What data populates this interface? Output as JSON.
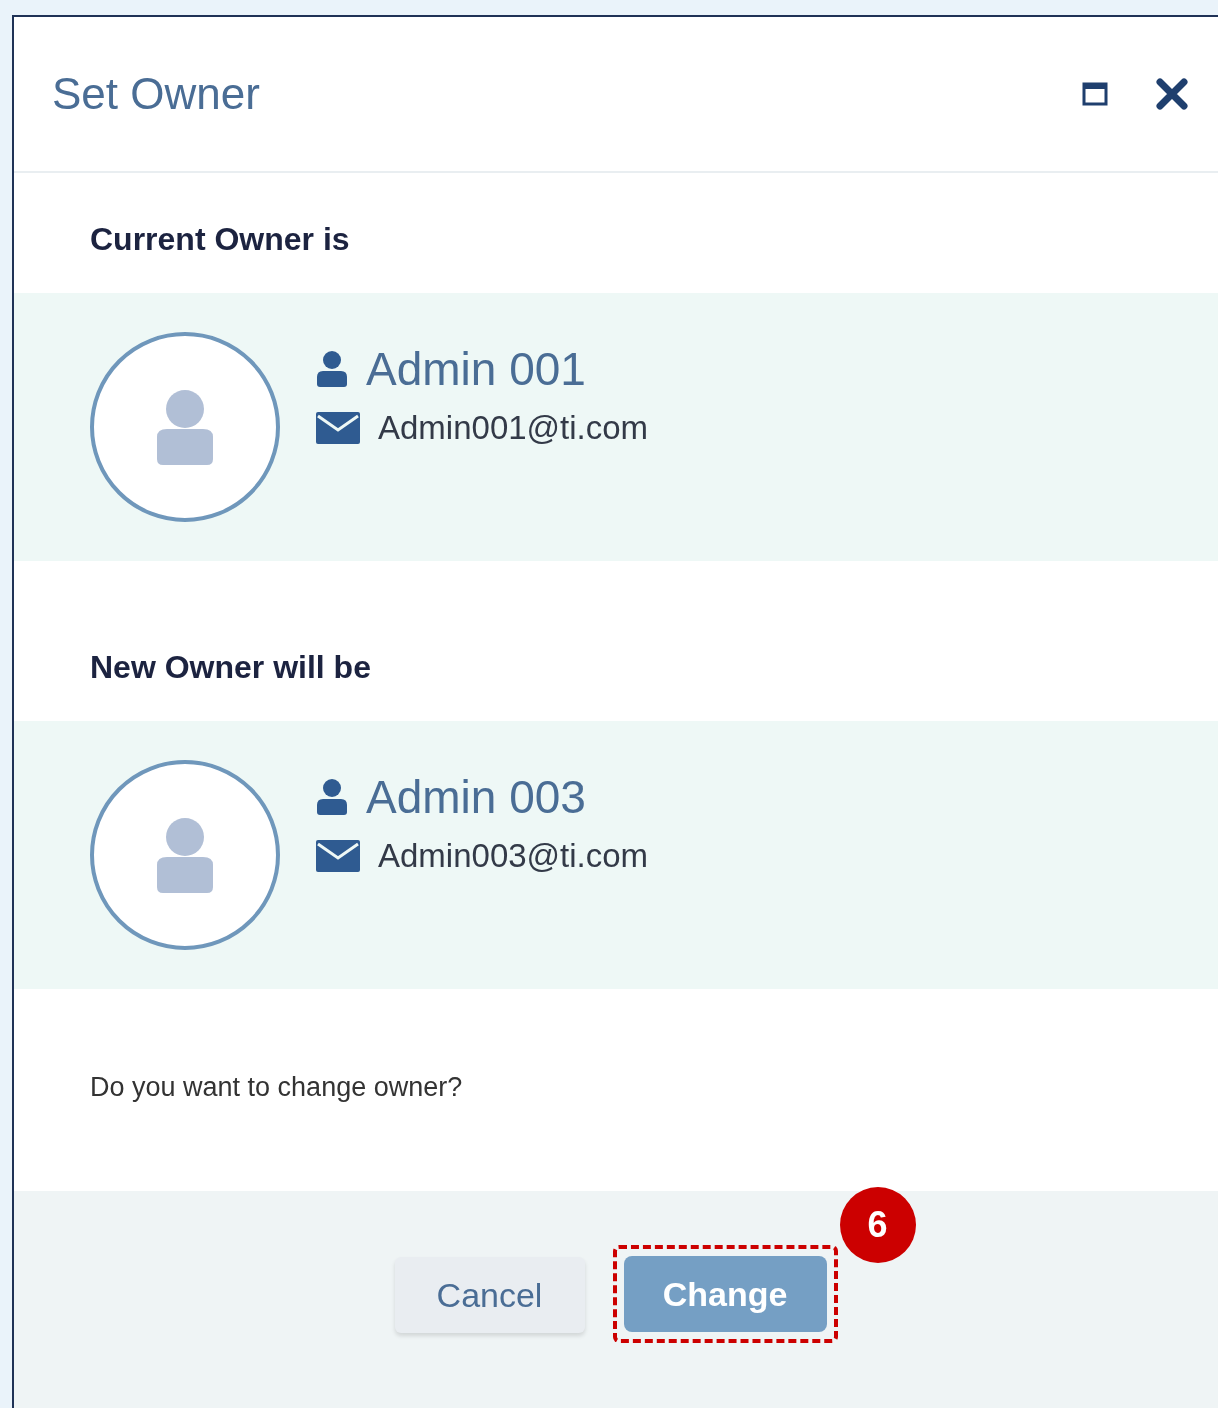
{
  "dialog": {
    "title": "Set Owner"
  },
  "sections": [
    {
      "heading": "Current Owner is",
      "owner": {
        "name": "Admin 001",
        "email": "Admin001@ti.com"
      }
    },
    {
      "heading": "New Owner will be",
      "owner": {
        "name": "Admin 003",
        "email": "Admin003@ti.com"
      }
    }
  ],
  "question": "Do you want to change owner?",
  "buttons": [
    {
      "label": "Cancel",
      "kind": "secondary"
    },
    {
      "label": "Change",
      "kind": "primary",
      "callout": "6"
    }
  ]
}
